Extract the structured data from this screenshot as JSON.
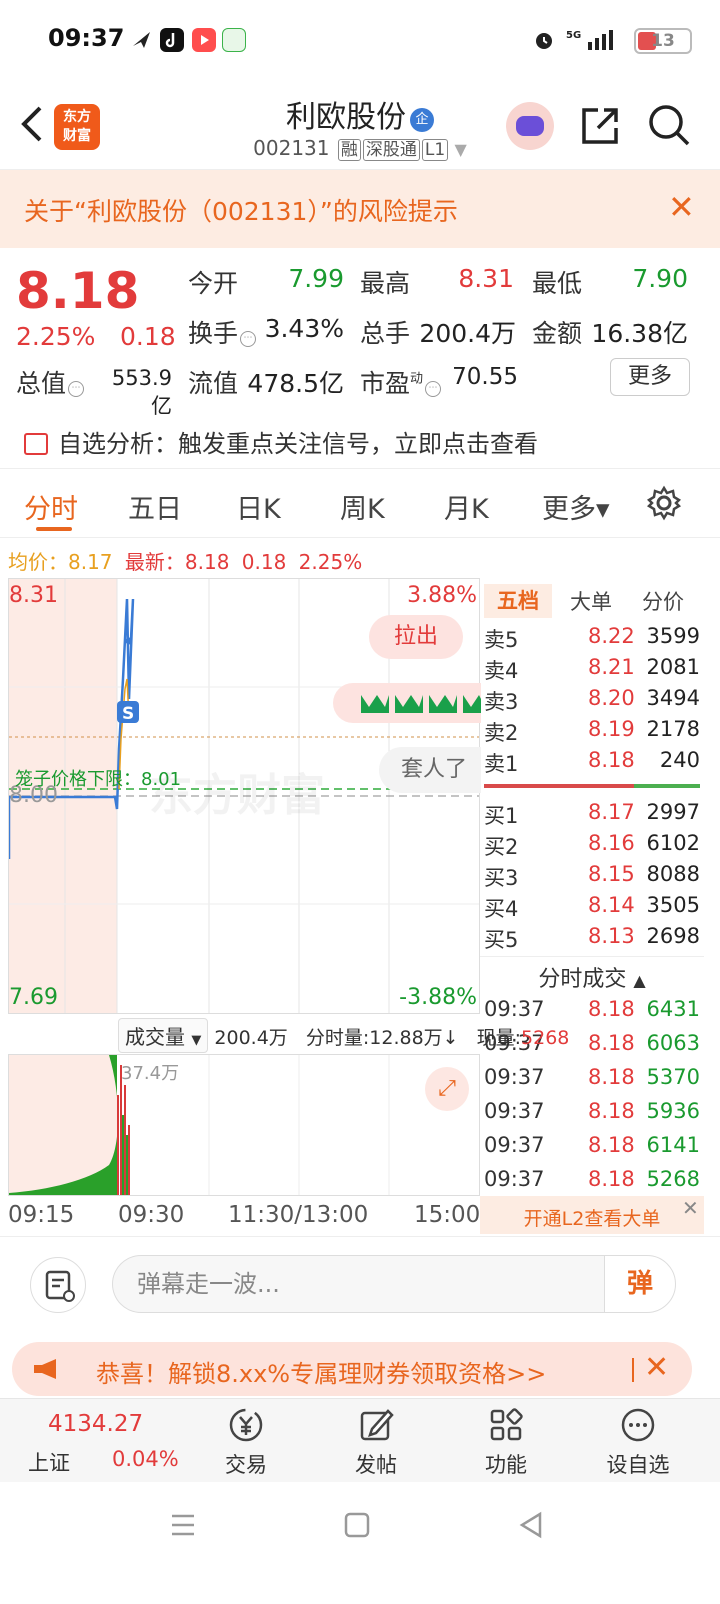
{
  "status": {
    "time": "09:37",
    "battery": "13",
    "network": "5G"
  },
  "header": {
    "logo_line1": "东方",
    "logo_line2": "财富",
    "stock_name": "利欧股份",
    "name_badge": "企",
    "code": "002131",
    "tags": [
      "融",
      "深股通",
      "L1"
    ]
  },
  "risk_banner": {
    "text": "关于“利欧股份（002131）”的风险提示"
  },
  "quote": {
    "price": "8.18",
    "change_pct": "2.25%",
    "change": "0.18",
    "open_label": "今开",
    "open": "7.99",
    "high_label": "最高",
    "high": "8.31",
    "low_label": "最低",
    "low": "7.90",
    "turnover_label": "换手",
    "turnover": "3.43%",
    "volume_label": "总手",
    "volume": "200.4万",
    "amount_label": "金额",
    "amount": "16.38亿",
    "mcap_label": "总值",
    "mcap": "553.9亿",
    "float_label": "流值",
    "float": "478.5亿",
    "pe_label": "市盈",
    "pe_sup": "动",
    "pe": "70.55",
    "more_label": "更多"
  },
  "signal": {
    "text": "自选分析：触发重点关注信号，立即点击查看"
  },
  "tabs": [
    {
      "label": "分时"
    },
    {
      "label": "五日"
    },
    {
      "label": "日K"
    },
    {
      "label": "周K"
    },
    {
      "label": "月K"
    },
    {
      "label": "更多▾"
    }
  ],
  "avg_row": {
    "avg_label": "均价：",
    "avg": "8.17",
    "latest_label": "最新：",
    "latest": "8.18",
    "change": "0.18",
    "change_pct": "2.25%"
  },
  "chart": {
    "y_top": "8.31",
    "y_bottom": "7.69",
    "y_mid": "8.00",
    "pct_top": "3.88%",
    "pct_bottom": "-3.88%",
    "pull_label": "拉出",
    "trapped_label": "套人了",
    "watermark": "东方财富",
    "cage_label": "笼子价格下限：8.01",
    "s_badge": "S"
  },
  "orderbook": {
    "tabs": [
      "五档",
      "大单",
      "分价"
    ],
    "asks": [
      {
        "label": "卖5",
        "price": "8.22",
        "vol": "3599"
      },
      {
        "label": "卖4",
        "price": "8.21",
        "vol": "2081"
      },
      {
        "label": "卖3",
        "price": "8.20",
        "vol": "3494"
      },
      {
        "label": "卖2",
        "price": "8.19",
        "vol": "2178"
      },
      {
        "label": "卖1",
        "price": "8.18",
        "vol": "240"
      }
    ],
    "bids": [
      {
        "label": "买1",
        "price": "8.17",
        "vol": "2997"
      },
      {
        "label": "买2",
        "price": "8.16",
        "vol": "6102"
      },
      {
        "label": "买3",
        "price": "8.15",
        "vol": "8088"
      },
      {
        "label": "买4",
        "price": "8.14",
        "vol": "3505"
      },
      {
        "label": "买5",
        "price": "8.13",
        "vol": "2698"
      }
    ]
  },
  "ticks": {
    "title": "分时成交",
    "rows": [
      {
        "time": "09:37",
        "price": "8.18",
        "vol": "6431"
      },
      {
        "time": "09:37",
        "price": "8.18",
        "vol": "6063"
      },
      {
        "time": "09:37",
        "price": "8.18",
        "vol": "5370"
      },
      {
        "time": "09:37",
        "price": "8.18",
        "vol": "5936"
      },
      {
        "time": "09:37",
        "price": "8.18",
        "vol": "6141"
      },
      {
        "time": "09:37",
        "price": "8.18",
        "vol": "5268"
      }
    ],
    "l2_text": "开通L2查看大单"
  },
  "volume": {
    "select_label": "成交量",
    "total": "200.4万",
    "period_label": "分时量:12.88万↓",
    "current_label": "现量:",
    "current": "5268",
    "max_label": "37.4万"
  },
  "x_axis": [
    "09:15",
    "09:30",
    "11:30/13:00",
    "15:00"
  ],
  "comment": {
    "placeholder": "弹幕走一波...",
    "send_label": "弹"
  },
  "promo": {
    "text": "恭喜！解锁8.xx%专属理财券领取资格>>"
  },
  "bottom_nav": {
    "index_value": "4134.27",
    "index_name": "上证",
    "index_pct": "0.04%",
    "items": [
      {
        "label": "交易"
      },
      {
        "label": "发帖"
      },
      {
        "label": "功能"
      },
      {
        "label": "设自选"
      }
    ]
  },
  "colors": {
    "up": "#e23b3b",
    "down": "#1a9a2f",
    "accent": "#e8661f"
  }
}
